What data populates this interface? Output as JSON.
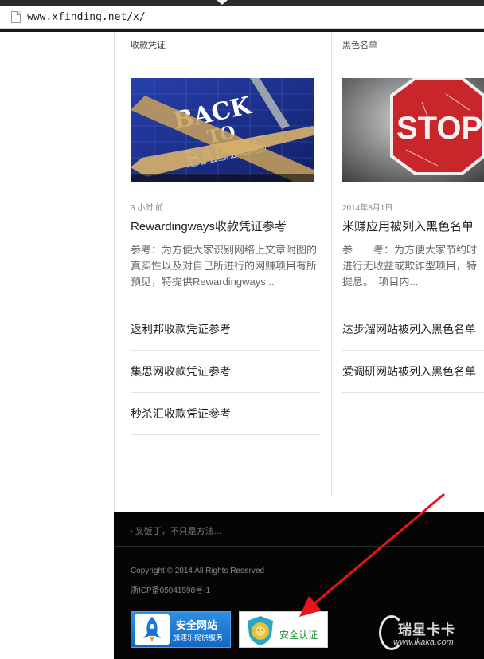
{
  "browser": {
    "url": "www.xfinding.net/x/"
  },
  "columns": [
    {
      "category": "收款凭证",
      "featured": {
        "image_text_line1": "BACK",
        "image_text_line2": "TO",
        "image_text_line3": "BASICS",
        "date": "3 小时 前",
        "title": "Rewardingways收款凭证参考",
        "excerpt": "参考：为方便大家识别网络上文章附图的真实性以及对自己所进行的网赚项目有所预见，特提供Rewardingways..."
      },
      "links": [
        "返利邦收款凭证参考",
        "集思网收款凭证参考",
        "秒杀汇收款凭证参考"
      ]
    },
    {
      "category": "黑色名单",
      "featured": {
        "image_text": "STOP",
        "date": "2014年8月1日",
        "title": "米赚应用被列入黑色名单",
        "excerpt": "参　　考：为方便大家节约时进行无收益或欺诈型项目，特提息。　项目内..."
      },
      "links": [
        "达步溜网站被列入黑色名单",
        "爱调研网站被列入黑色名单"
      ]
    }
  ],
  "footer": {
    "tagline": "› 叉饭丁，不只是方法...",
    "copyright": "Copyright © 2014   All Rights Reserved",
    "icp": "浙ICP备05041598号-1",
    "badge_safe_site": {
      "title": "安全网站",
      "subtitle": "加速乐提供服务",
      "color": "#1a78d2"
    },
    "badge_security_cert": {
      "label": "安全认证",
      "color": "#1d8f3a"
    }
  },
  "watermark": {
    "title": "瑞星卡卡",
    "url": "www.ikaka.com"
  },
  "annotation": {
    "arrow_color": "#e8141a"
  }
}
